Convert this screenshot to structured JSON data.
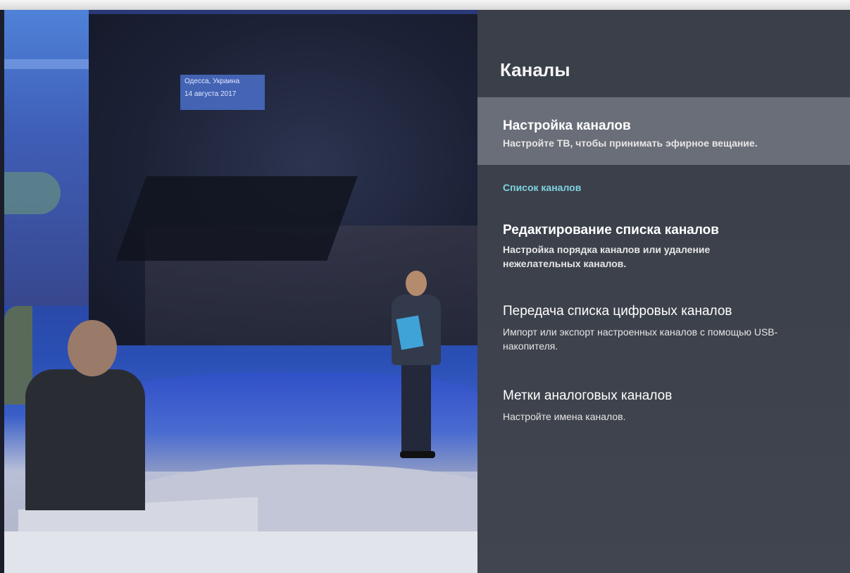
{
  "broadcast": {
    "caption_line1": "Одесса, Украина",
    "caption_line2": "14 августа 2017"
  },
  "panel": {
    "title": "Каналы",
    "section_header": "Список каналов",
    "items": [
      {
        "title": "Настройка каналов",
        "subtitle": "Настройте ТВ, чтобы принимать эфирное вещание.",
        "selected": true
      },
      {
        "title": "Редактирование списка каналов",
        "subtitle": "Настройка порядка каналов или удаление нежелательных каналов.",
        "selected": false
      },
      {
        "title": "Передача списка цифровых каналов",
        "subtitle": "Импорт или экспорт настроенных каналов с помощью USB-накопителя.",
        "selected": false
      },
      {
        "title": "Метки аналоговых каналов",
        "subtitle": "Настройте имена каналов.",
        "selected": false
      }
    ]
  },
  "colors": {
    "panel_bg": "#3c414b",
    "selected_bg": "#6a6e78",
    "section_header": "#7fd3e0"
  }
}
